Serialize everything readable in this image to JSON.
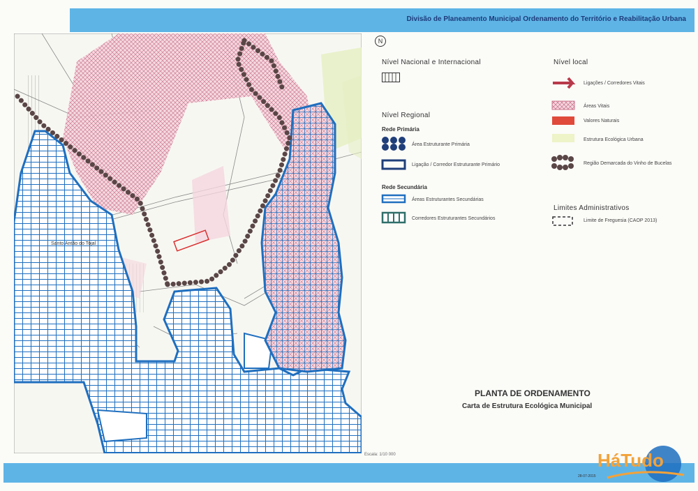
{
  "header": {
    "title": "Divisão de Planeamento Municipal Ordenamento do Território e Reabilitação Urbana"
  },
  "legend": {
    "nacional_heading": "Nível Nacional e Internacional",
    "regional_heading": "Nível Regional",
    "rede_primaria": "Rede Primária",
    "area_estruturante_primaria": "Área Estruturante Primária",
    "ligacao_corredor_primario": "Ligação / Corredor Estruturante Primário",
    "rede_secundaria": "Rede Secundária",
    "areas_estruturantes_secundarias": "Áreas Estruturantes Secundárias",
    "corredores_estruturantes_secundarios": "Corredores Estruturantes Secundários",
    "local_heading": "Nível local",
    "ligacoes_corredores_vitais": "Ligações / Corredores Vitais",
    "areas_vitais": "Áreas Vitais",
    "valores_naturais": "Valores Naturais",
    "estrutura_ecologica_urbana": "Estrutura Ecológica Urbana",
    "regiao_demarcada": "Região Demarcada do Vinho de Bucelas",
    "limites_heading": "Limites Administrativos",
    "limite_freguesia": "Limite de Freguesia (CAOP 2013)"
  },
  "map": {
    "place_label": "Santo Antão do Tojal",
    "north_symbol": "N"
  },
  "title": {
    "main": "PLANTA DE ORDENAMENTO",
    "sub": "Carta de Estrutura Ecológica Municipal"
  },
  "scale": "Escala: 1/10 000",
  "watermark": "HáTudo",
  "date": "28-07-2015",
  "colors": {
    "blue_band": "#5fb4e6",
    "secondary_area": "#1f6fbf",
    "vital_area": "#e8b4c4",
    "primary_corridor": "#4a3b3a"
  }
}
